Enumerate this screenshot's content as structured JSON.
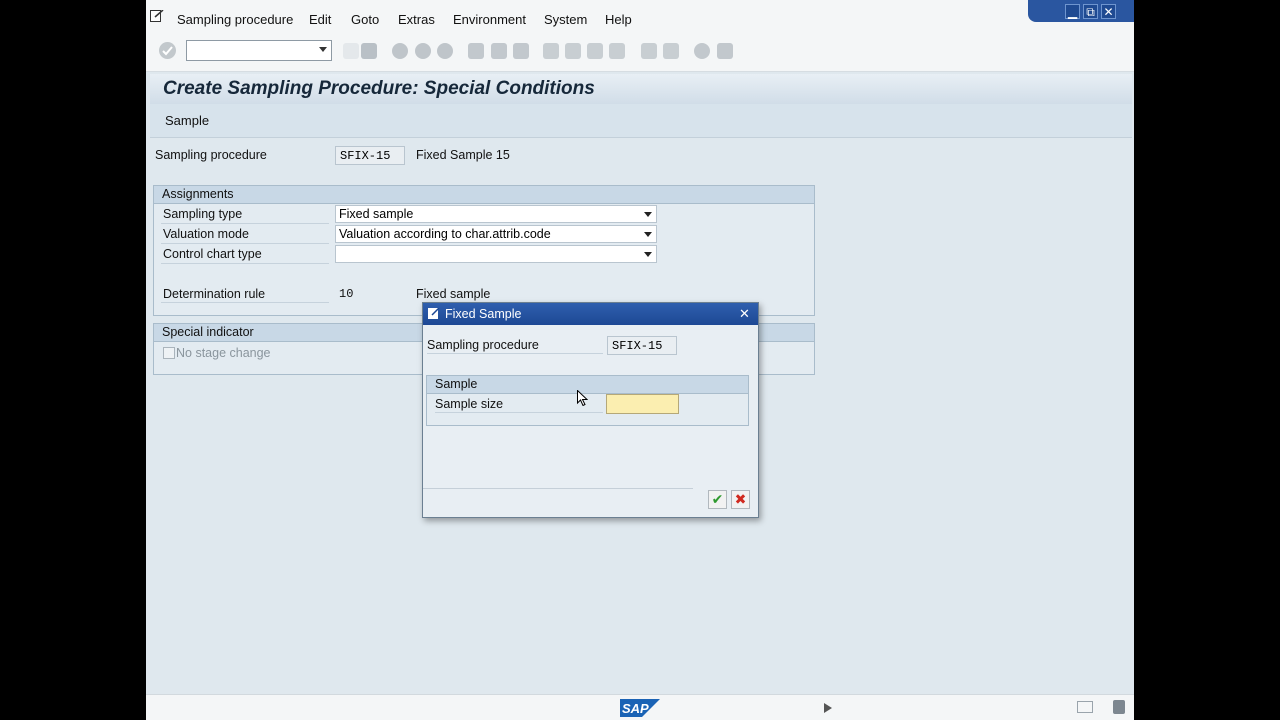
{
  "menu": {
    "items": [
      "Sampling procedure",
      "Edit",
      "Goto",
      "Extras",
      "Environment",
      "System",
      "Help"
    ]
  },
  "window_controls": {
    "minimize": "▁",
    "restore": "⧉",
    "close": "✕"
  },
  "title": "Create Sampling Procedure: Special Conditions",
  "app_toolbar": {
    "sample_button": "Sample"
  },
  "header": {
    "sampling_procedure_label": "Sampling procedure",
    "sampling_procedure_value": "SFIX-15",
    "sampling_procedure_text": "Fixed Sample 15"
  },
  "assignments": {
    "title": "Assignments",
    "sampling_type_label": "Sampling type",
    "sampling_type_value": "Fixed sample",
    "valuation_mode_label": "Valuation mode",
    "valuation_mode_value": "Valuation according to char.attrib.code",
    "control_chart_type_label": "Control chart type",
    "control_chart_type_value": "",
    "determination_rule_label": "Determination rule",
    "determination_rule_value": "10",
    "determination_rule_text": "Fixed sample"
  },
  "special_indicator": {
    "title": "Special indicator",
    "no_stage_change_label": "No stage change",
    "no_stage_change_checked": false
  },
  "dialog": {
    "title": "Fixed Sample",
    "sampling_procedure_label": "Sampling procedure",
    "sampling_procedure_value": "SFIX-15",
    "sample_group_title": "Sample",
    "sample_size_label": "Sample size",
    "sample_size_value": "",
    "confirm_icon": "✔",
    "cancel_icon": "✖"
  },
  "status": {
    "logo_text": "SAP"
  },
  "colors": {
    "accent": "#1d4894",
    "background": "#dfe8ee",
    "required_field": "#fbeeb0"
  }
}
